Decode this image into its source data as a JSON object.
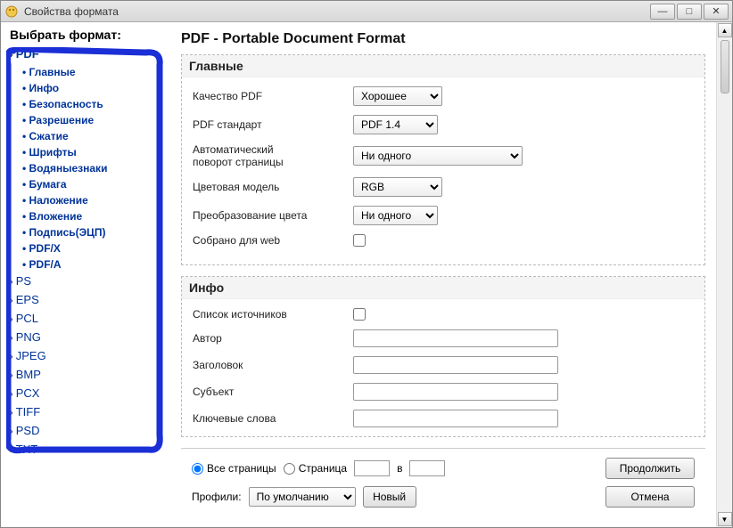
{
  "titlebar": {
    "text": "Свойства формата"
  },
  "sidebar": {
    "title": "Выбрать формат:",
    "formats": [
      "PDF",
      "PS",
      "EPS",
      "PCL",
      "PNG",
      "JPEG",
      "BMP",
      "PCX",
      "TIFF",
      "PSD",
      "TXT"
    ],
    "pdf_subitems": [
      "Главные",
      "Инфо",
      "Безопасность",
      "Разрешение",
      "Сжатие",
      "Шрифты",
      "Водяныезнаки",
      "Бумага",
      "Наложение",
      "Вложение",
      "Подпись(ЭЦП)",
      "PDF/X",
      "PDF/A"
    ]
  },
  "content": {
    "title": "PDF - Portable Document Format",
    "main_panel": {
      "title": "Главные",
      "quality": {
        "label": "Качество PDF",
        "value": "Хорошее"
      },
      "standard": {
        "label": "PDF стандарт",
        "value": "PDF 1.4"
      },
      "autorotate": {
        "label1": "Автоматический",
        "label2": "поворот страницы",
        "value": "Ни одного"
      },
      "colormodel": {
        "label": "Цветовая модель",
        "value": "RGB"
      },
      "colortrans": {
        "label": "Преобразование цвета",
        "value": "Ни одного"
      },
      "webready": {
        "label": "Собрано для web"
      }
    },
    "info_panel": {
      "title": "Инфо",
      "sources": {
        "label": "Список источников"
      },
      "author": {
        "label": "Автор",
        "value": ""
      },
      "heading": {
        "label": "Заголовок",
        "value": ""
      },
      "subject": {
        "label": "Субъект",
        "value": ""
      },
      "keywords": {
        "label": "Ключевые слова",
        "value": ""
      }
    }
  },
  "bottom": {
    "all_pages": "Все страницы",
    "page": "Страница",
    "in": "в",
    "continue": "Продолжить",
    "cancel": "Отмена",
    "profiles_label": "Профили:",
    "profiles_value": "По умолчанию",
    "new": "Новый"
  }
}
